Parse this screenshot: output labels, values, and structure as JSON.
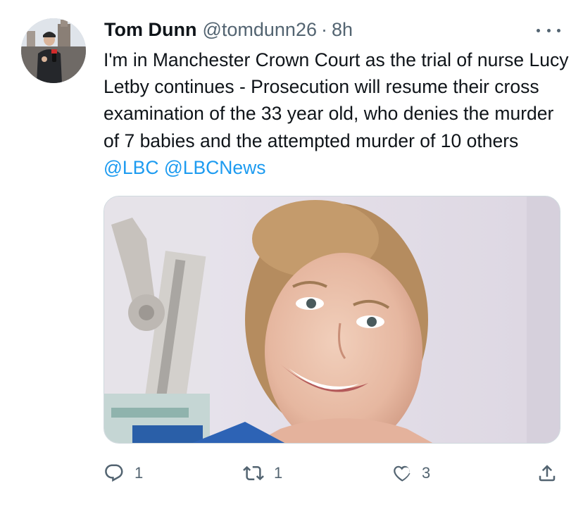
{
  "author": {
    "display_name": "Tom Dunn",
    "handle": "@tomdunn26",
    "separator": "·",
    "timestamp": "8h"
  },
  "tweet": {
    "text_segments": [
      "I'm in Manchester Crown Court as the trial of nurse Lucy Letby continues - Prosecution will resume their cross examination of the 33 year old, who denies the murder of 7 babies and the attempted murder of 10 others",
      "@LBC",
      "@LBCNews"
    ]
  },
  "actions": {
    "reply": {
      "icon": "reply-icon",
      "count": "1"
    },
    "retweet": {
      "icon": "retweet-icon",
      "count": "1"
    },
    "like": {
      "icon": "heart-icon",
      "count": "3"
    },
    "share": {
      "icon": "share-icon"
    }
  },
  "colors": {
    "text": "#0f1419",
    "secondary": "#536471",
    "link": "#1d9bf0",
    "border": "#cfd9de"
  }
}
